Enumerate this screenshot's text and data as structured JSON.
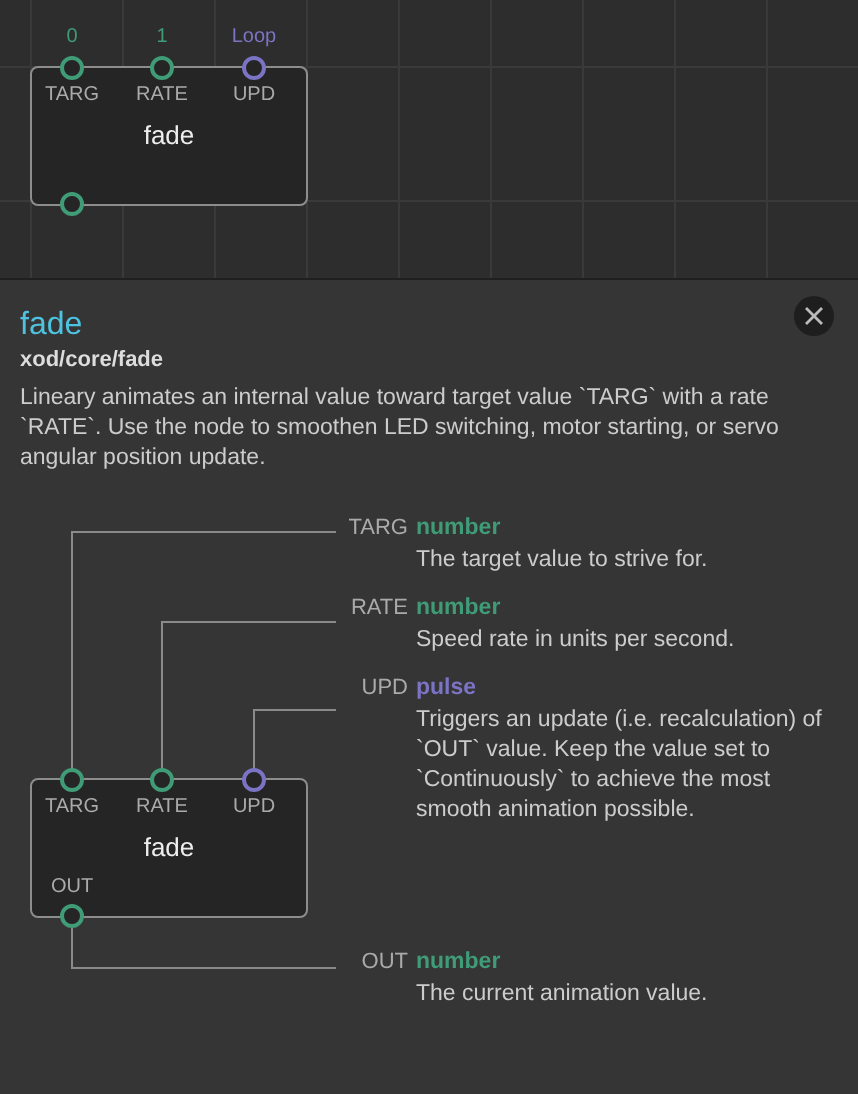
{
  "canvas_node": {
    "title": "fade",
    "inputs": [
      {
        "label": "TARG",
        "value": "0",
        "kind": "number"
      },
      {
        "label": "RATE",
        "value": "1",
        "kind": "number"
      },
      {
        "label": "UPD",
        "value": "Loop",
        "kind": "pulse"
      }
    ],
    "outputs": [
      {
        "kind": "number"
      }
    ]
  },
  "panel": {
    "title": "fade",
    "path": "xod/core/fade",
    "description": "Lineary animates an internal value toward target value `TARG` with a rate `RATE`. Use the node to smoothen LED switching, motor starting, or servo angular position update.",
    "node": {
      "title": "fade",
      "inputs": [
        {
          "label": "TARG",
          "kind": "number"
        },
        {
          "label": "RATE",
          "kind": "number"
        },
        {
          "label": "UPD",
          "kind": "pulse"
        }
      ],
      "outputs": [
        {
          "label": "OUT",
          "kind": "number"
        }
      ]
    },
    "inputs": [
      {
        "name": "TARG",
        "data_type": "number",
        "kind": "number",
        "description": "The target value to strive for."
      },
      {
        "name": "RATE",
        "data_type": "number",
        "kind": "number",
        "description": "Speed rate in units per second."
      },
      {
        "name": "UPD",
        "data_type": "pulse",
        "kind": "pulse",
        "description": "Triggers an update (i.e. recalculation) of `OUT` value. Keep the value set to `Continuously` to achieve the most smooth animation possible."
      }
    ],
    "outputs": [
      {
        "name": "OUT",
        "data_type": "number",
        "kind": "number",
        "description": "The current animation value."
      }
    ]
  }
}
